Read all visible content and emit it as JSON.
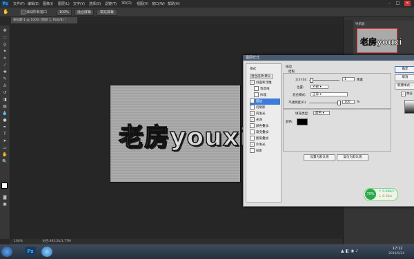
{
  "menubar": {
    "logo": "Ps",
    "items": [
      "文件(F)",
      "编辑(E)",
      "图像(I)",
      "图层(L)",
      "文字(Y)",
      "选择(S)",
      "滤镜(T)",
      "3D(D)",
      "视图(V)",
      "窗口(W)",
      "帮助(H)"
    ],
    "minimize": "–",
    "maximize": "□",
    "close": "✕"
  },
  "options": {
    "scroll_all": "滚动所有窗口",
    "zoom_100": "100%",
    "fit_screen": "适合屏幕",
    "fill_screen": "填充屏幕"
  },
  "document": {
    "tab": "未标题-1 @ 100% (图层 1, RGB/8) *",
    "art_text": "老房youxi",
    "zoom": "100%",
    "doc_info": "文档:493.2K/1.77M"
  },
  "navigator": {
    "tab": "导航器",
    "thumb_text": "老房youxi"
  },
  "dialog": {
    "title": "图层样式",
    "styles_header": "样式",
    "blend_options": "混合选项:默认",
    "effects": [
      {
        "label": "斜面和浮雕",
        "checked": true
      },
      {
        "label": "等高线",
        "checked": false
      },
      {
        "label": "纹理",
        "checked": false
      },
      {
        "label": "描边",
        "checked": true,
        "selected": true
      },
      {
        "label": "内阴影",
        "checked": false
      },
      {
        "label": "内发光",
        "checked": true
      },
      {
        "label": "光泽",
        "checked": true
      },
      {
        "label": "颜色叠加",
        "checked": false
      },
      {
        "label": "渐变叠加",
        "checked": false
      },
      {
        "label": "图案叠加",
        "checked": false
      },
      {
        "label": "外发光",
        "checked": true
      },
      {
        "label": "投影",
        "checked": false
      }
    ],
    "section": "描边",
    "structure": "结构",
    "size_label": "大小(S):",
    "size_value": "1",
    "size_unit": "像素",
    "position_label": "位置:",
    "position_value": "外部",
    "blend_label": "混合模式:",
    "blend_value": "正常",
    "opacity_label": "不透明度(O):",
    "opacity_value": "100",
    "opacity_unit": "%",
    "fill_type_label": "填充类型:",
    "fill_type_value": "颜色",
    "color_label": "颜色:",
    "stroke_color": "#000000",
    "set_default": "设置为默认值",
    "reset_default": "复位为默认值",
    "ok": "确定",
    "cancel": "取消",
    "new_style": "新建样式...",
    "preview": "预览"
  },
  "widget": {
    "percent": "70%",
    "up": "0.06K/s",
    "down": "0.1K/s"
  },
  "taskbar": {
    "time": "17:12",
    "date": "2016/5/24"
  }
}
